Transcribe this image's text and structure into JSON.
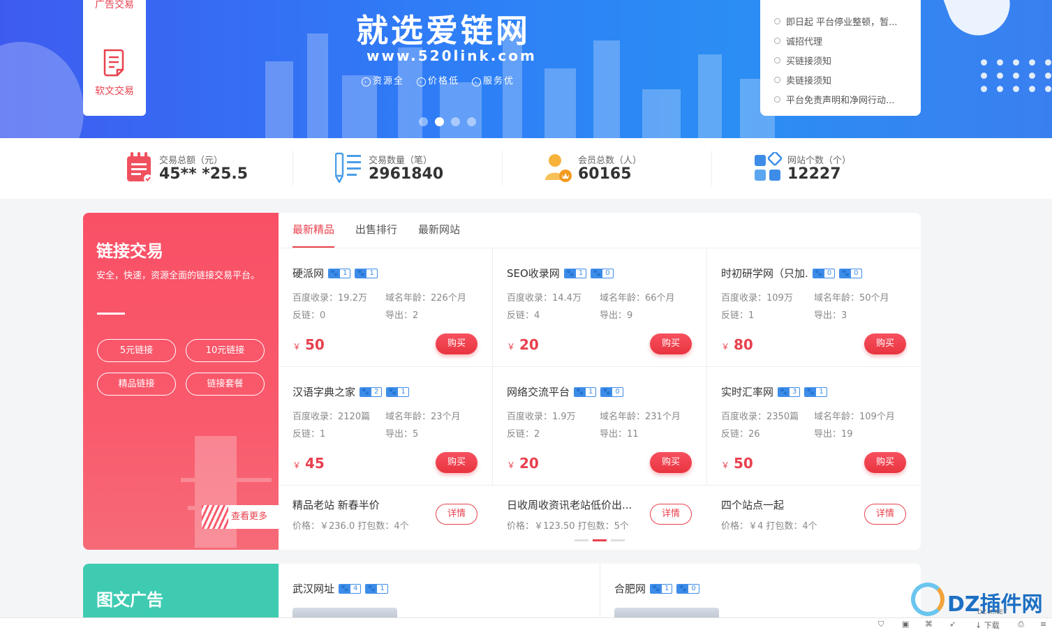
{
  "banner": {
    "title": "就选爱链网",
    "url": "www.520link.com",
    "tags": [
      "资源全",
      "价格低",
      "服务优"
    ],
    "slides": 4,
    "active_slide": 2
  },
  "side_nav": {
    "top_item": "广告交易",
    "item": "软文交易"
  },
  "notices": [
    "即日起 平台停业整顿，暂...",
    "诚招代理",
    "买链接须知",
    "卖链接须知",
    "平台免责声明和净网行动..."
  ],
  "stats": [
    {
      "label": "交易总额（元）",
      "value": "45**  *25.5",
      "icon": "calendar-icon"
    },
    {
      "label": "交易数量（笔）",
      "value": "2961840",
      "icon": "pencil-list-icon"
    },
    {
      "label": "会员总数（人）",
      "value": "60165",
      "icon": "member-icon"
    },
    {
      "label": "网站个数（个）",
      "value": "12227",
      "icon": "apps-icon"
    }
  ],
  "link_section": {
    "title": "链接交易",
    "desc": "安全，快速，资源全面的链接交易平台。",
    "pills": [
      "5元链接",
      "10元链接",
      "精品链接",
      "链接套餐"
    ],
    "more": "查看更多",
    "tabs": [
      "最新精品",
      "出售排行",
      "最新网站"
    ],
    "active_tab": 0,
    "cards": [
      {
        "name": "硬派网",
        "b1": "1",
        "b2": "1",
        "baidu": "百度收录：19.2万",
        "age": "域名年龄：226个月",
        "backlinks": "反链：0",
        "export": "导出：2",
        "price": "50"
      },
      {
        "name": "SEO收录网",
        "b1": "1",
        "b2": "0",
        "baidu": "百度收录：14.4万",
        "age": "域名年龄：66个月",
        "backlinks": "反链：4",
        "export": "导出：9",
        "price": "20"
      },
      {
        "name": "时初研学网（只加.",
        "b1": "0",
        "b2": "0",
        "baidu": "百度收录：109万",
        "age": "域名年龄：50个月",
        "backlinks": "反链：1",
        "export": "导出：3",
        "price": "80"
      },
      {
        "name": "汉语字典之家",
        "b1": "2",
        "b2": "1",
        "baidu": "百度收录：2120篇",
        "age": "域名年龄：23个月",
        "backlinks": "反链：1",
        "export": "导出：5",
        "price": "45"
      },
      {
        "name": "网络交流平台",
        "b1": "1",
        "b2": "0",
        "baidu": "百度收录：1.9万",
        "age": "域名年龄：231个月",
        "backlinks": "反链：2",
        "export": "导出：11",
        "price": "20"
      },
      {
        "name": "实时汇率网",
        "b1": "3",
        "b2": "1",
        "baidu": "百度收录：2350篇",
        "age": "域名年龄：109个月",
        "backlinks": "反链：26",
        "export": "导出：19",
        "price": "50"
      }
    ],
    "buy_label": "购买",
    "currency": "￥",
    "packages": [
      {
        "title": "精品老站 新春半价",
        "meta": "价格：￥236.0   打包数：4个"
      },
      {
        "title": "日收周收资讯老站低价出...",
        "meta": "价格：￥123.50   打包数：5个"
      },
      {
        "title": "四个站点一起",
        "meta": "价格：￥4   打包数：4个"
      }
    ],
    "detail_label": "详情"
  },
  "ad_section": {
    "title": "图文广告",
    "items": [
      {
        "name": "武汉网址",
        "b1": "4",
        "b2": "1"
      },
      {
        "name": "合肥网",
        "b1": "1",
        "b2": "0"
      }
    ]
  },
  "bottombar": {
    "download": "下载"
  },
  "watermark": {
    "text": "DZ插件网",
    "sub": "DZ-X.NET"
  },
  "colors": {
    "accent_red": "#e8404d",
    "link_blue": "#3d8ce8",
    "teal": "#3fcbb2"
  }
}
